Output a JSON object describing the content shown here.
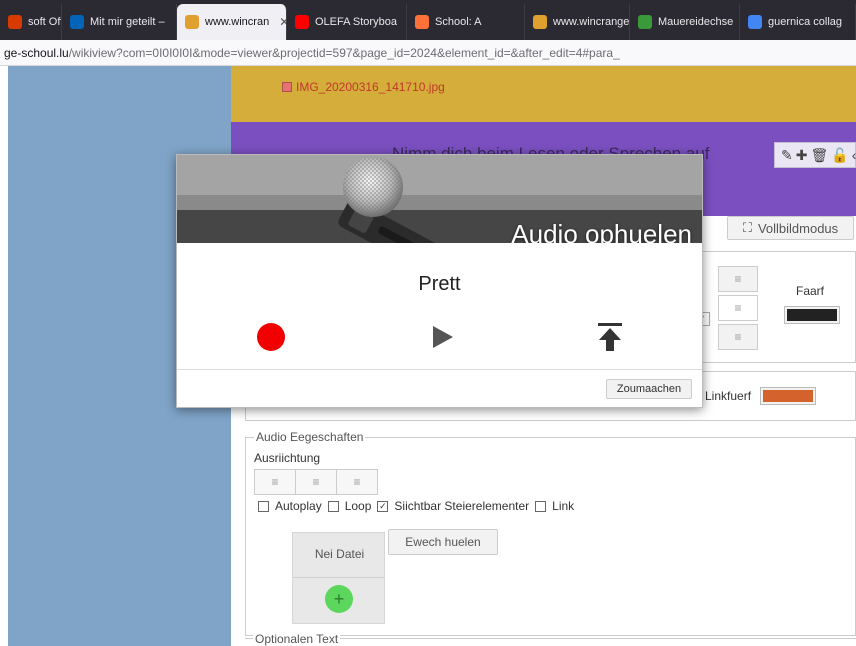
{
  "browser": {
    "tabs": [
      {
        "label": "soft Office",
        "icon": "office-icon",
        "color": "#d83b01"
      },
      {
        "label": "Mit mir geteilt –",
        "icon": "onedrive-icon",
        "color": "#0364b8"
      },
      {
        "label": "www.wincran",
        "icon": "wincrange-icon",
        "color": "#e0a030",
        "active": true
      },
      {
        "label": "OLEFA Storyboa",
        "icon": "youtube-icon",
        "color": "#ff0000"
      },
      {
        "label": "School: A",
        "icon": "firefox-icon",
        "color": "#ff7139"
      },
      {
        "label": "www.wincrange",
        "icon": "wincrange-icon",
        "color": "#e0a030"
      },
      {
        "label": "Mauereidechse",
        "icon": "lizard-icon",
        "color": "#3a9a3a"
      },
      {
        "label": "guernica collag",
        "icon": "google-icon",
        "color": "#4285f4"
      }
    ],
    "url_domain": "ge-schoul.lu",
    "url_path": "/wikiview?com=0I0I0I0I&mode=viewer&projectid=597&page_id=2024&element_id=&after_edit=4#para_"
  },
  "page": {
    "image_link": "IMG_20200316_141710.jpg",
    "purple_title": "Nimm dich beim Lesen oder Sprechen auf",
    "vollbild_label": "Vollbildmodus",
    "faarf_label": "Faarf",
    "linkfuerf_label": "Linkfuerf",
    "audio_legend": "Audio Eegeschaften",
    "ausriichtung_label": "Ausriichtung",
    "checkboxes": [
      {
        "label": "Autoplay",
        "checked": false
      },
      {
        "label": "Loop",
        "checked": false
      },
      {
        "label": "Siichtbar Steierelementer",
        "checked": true
      },
      {
        "label": "Link",
        "checked": false
      }
    ],
    "nei_datei_label": "Nei Datei",
    "ewech_label": "Ewech huelen",
    "optional_legend": "Optionalen Text"
  },
  "modal": {
    "title": "Audio ophuelen",
    "status": "Prett",
    "close_label": "Zoumaachen"
  },
  "colors": {
    "sidebar": "#7fa4c8",
    "yellow": "#d4ad3a",
    "purple": "#7b4fc0",
    "record": "#f20000",
    "faarf": "#222222",
    "linkfuerf": "#d4622c"
  }
}
